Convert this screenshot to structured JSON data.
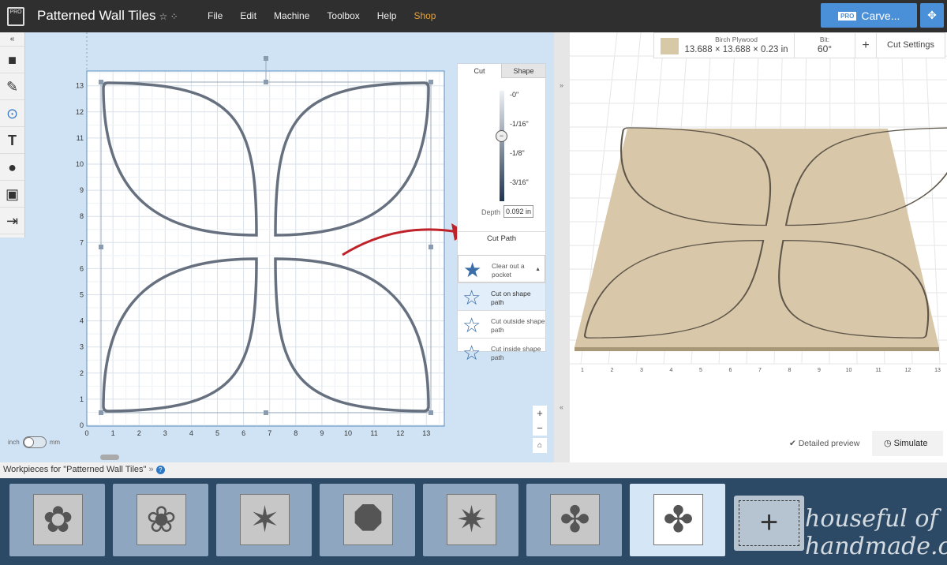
{
  "header": {
    "title": "Patterned Wall Tiles",
    "menu": [
      "File",
      "Edit",
      "Machine",
      "Toolbox",
      "Help",
      "Shop"
    ],
    "carve_badge": "PRO",
    "carve_label": "Carve...",
    "accent": "#4a90d9"
  },
  "material": {
    "name": "Birch Plywood",
    "dimensions": "13.688 × 13.688 × 0.23 in",
    "bit_label": "Bit:",
    "bit_value": "60°",
    "add": "+",
    "cut_settings": "Cut Settings"
  },
  "canvas": {
    "x_ticks": [
      "0",
      "1",
      "2",
      "3",
      "4",
      "5",
      "6",
      "7",
      "8",
      "9",
      "10",
      "11",
      "12",
      "13"
    ],
    "y_ticks": [
      "0",
      "1",
      "2",
      "3",
      "4",
      "5",
      "6",
      "7",
      "8",
      "9",
      "10",
      "11",
      "12",
      "13"
    ],
    "unit_left": "inch",
    "unit_right": "mm"
  },
  "cut_panel": {
    "tabs": [
      "Cut",
      "Shape"
    ],
    "depth_ticks": [
      "-0\"",
      "-1/16\"",
      "-1/8\"",
      "-3/16\""
    ],
    "depth_label": "Depth",
    "depth_value": "0.092 in",
    "cut_path_title": "Cut Path",
    "options": [
      {
        "label": "Clear out a pocket"
      },
      {
        "label": "Cut on shape path",
        "selected": true
      },
      {
        "label": "Cut outside shape path"
      },
      {
        "label": "Cut inside shape path"
      }
    ]
  },
  "preview": {
    "ruler": [
      "1",
      "2",
      "3",
      "4",
      "5",
      "6",
      "7",
      "8",
      "9",
      "10",
      "11",
      "12",
      "13"
    ],
    "detailed_preview": "Detailed preview",
    "simulate": "Simulate"
  },
  "workpieces": {
    "title": "Workpieces for \"Patterned Wall Tiles\"",
    "selected_index": 6,
    "count": 7
  },
  "watermark": "houseful of handmade.com"
}
